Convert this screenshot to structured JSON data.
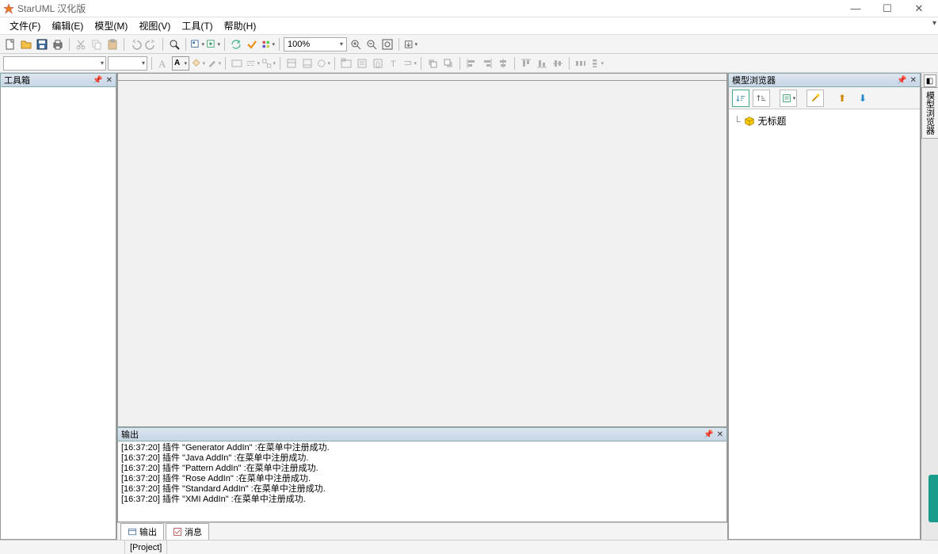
{
  "app": {
    "title": "StarUML 汉化版"
  },
  "menu": {
    "file": "文件(F)",
    "edit": "编辑(E)",
    "model": "模型(M)",
    "view": "视图(V)",
    "tool": "工具(T)",
    "help": "帮助(H)"
  },
  "toolbar": {
    "zoom": "100%"
  },
  "panels": {
    "toolbox_title": "工具箱",
    "browser_title": "模型浏览器",
    "browser_side_tab": "模型浏览器",
    "output_title": "输出"
  },
  "tree": {
    "root": "无标题"
  },
  "output": {
    "lines": [
      {
        "time": "[16:37:20]",
        "text": "插件 \"Generator AddIn\" :在菜单中注册成功."
      },
      {
        "time": "[16:37:20]",
        "text": "插件 \"Java AddIn\" :在菜单中注册成功."
      },
      {
        "time": "[16:37:20]",
        "text": "插件 \"Pattern AddIn\" :在菜单中注册成功."
      },
      {
        "time": "[16:37:20]",
        "text": "插件 \"Rose AddIn\" :在菜单中注册成功."
      },
      {
        "time": "[16:37:20]",
        "text": "插件 \"Standard AddIn\" :在菜单中注册成功."
      },
      {
        "time": "[16:37:20]",
        "text": "插件 \"XMI AddIn\" :在菜单中注册成功."
      }
    ]
  },
  "tabs": {
    "output": "输出",
    "message": "消息"
  },
  "status": {
    "project": "[Project]"
  }
}
